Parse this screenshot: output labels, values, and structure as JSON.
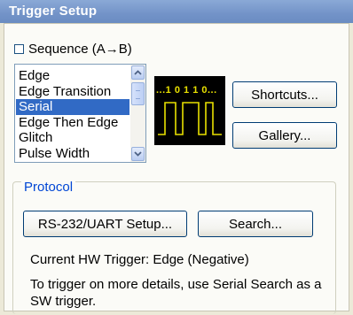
{
  "window": {
    "title": "Trigger Setup"
  },
  "sequence": {
    "label": "Sequence (A→B)",
    "checked": false
  },
  "trigger_types": {
    "items": [
      "Edge",
      "Edge Transition",
      "Serial",
      "Edge Then Edge",
      "Glitch",
      "Pulse Width"
    ],
    "selected": "Serial"
  },
  "preview": {
    "bits": "...1 0 1 1 0...",
    "icon": "serial-waveform-icon",
    "color": "#e8e000"
  },
  "buttons": {
    "shortcuts": "Shortcuts...",
    "gallery": "Gallery..."
  },
  "protocol": {
    "legend": "Protocol",
    "setup_button": "RS-232/UART Setup...",
    "search_button": "Search...",
    "current_trigger": "Current HW Trigger: Edge (Negative)",
    "hint": "To trigger on more details, use Serial Search as a SW trigger."
  },
  "colors": {
    "titlebar": "#7393c8",
    "selection": "#316ac5",
    "legend_text": "#0046d5",
    "waveform_trace": "#e8e000"
  }
}
